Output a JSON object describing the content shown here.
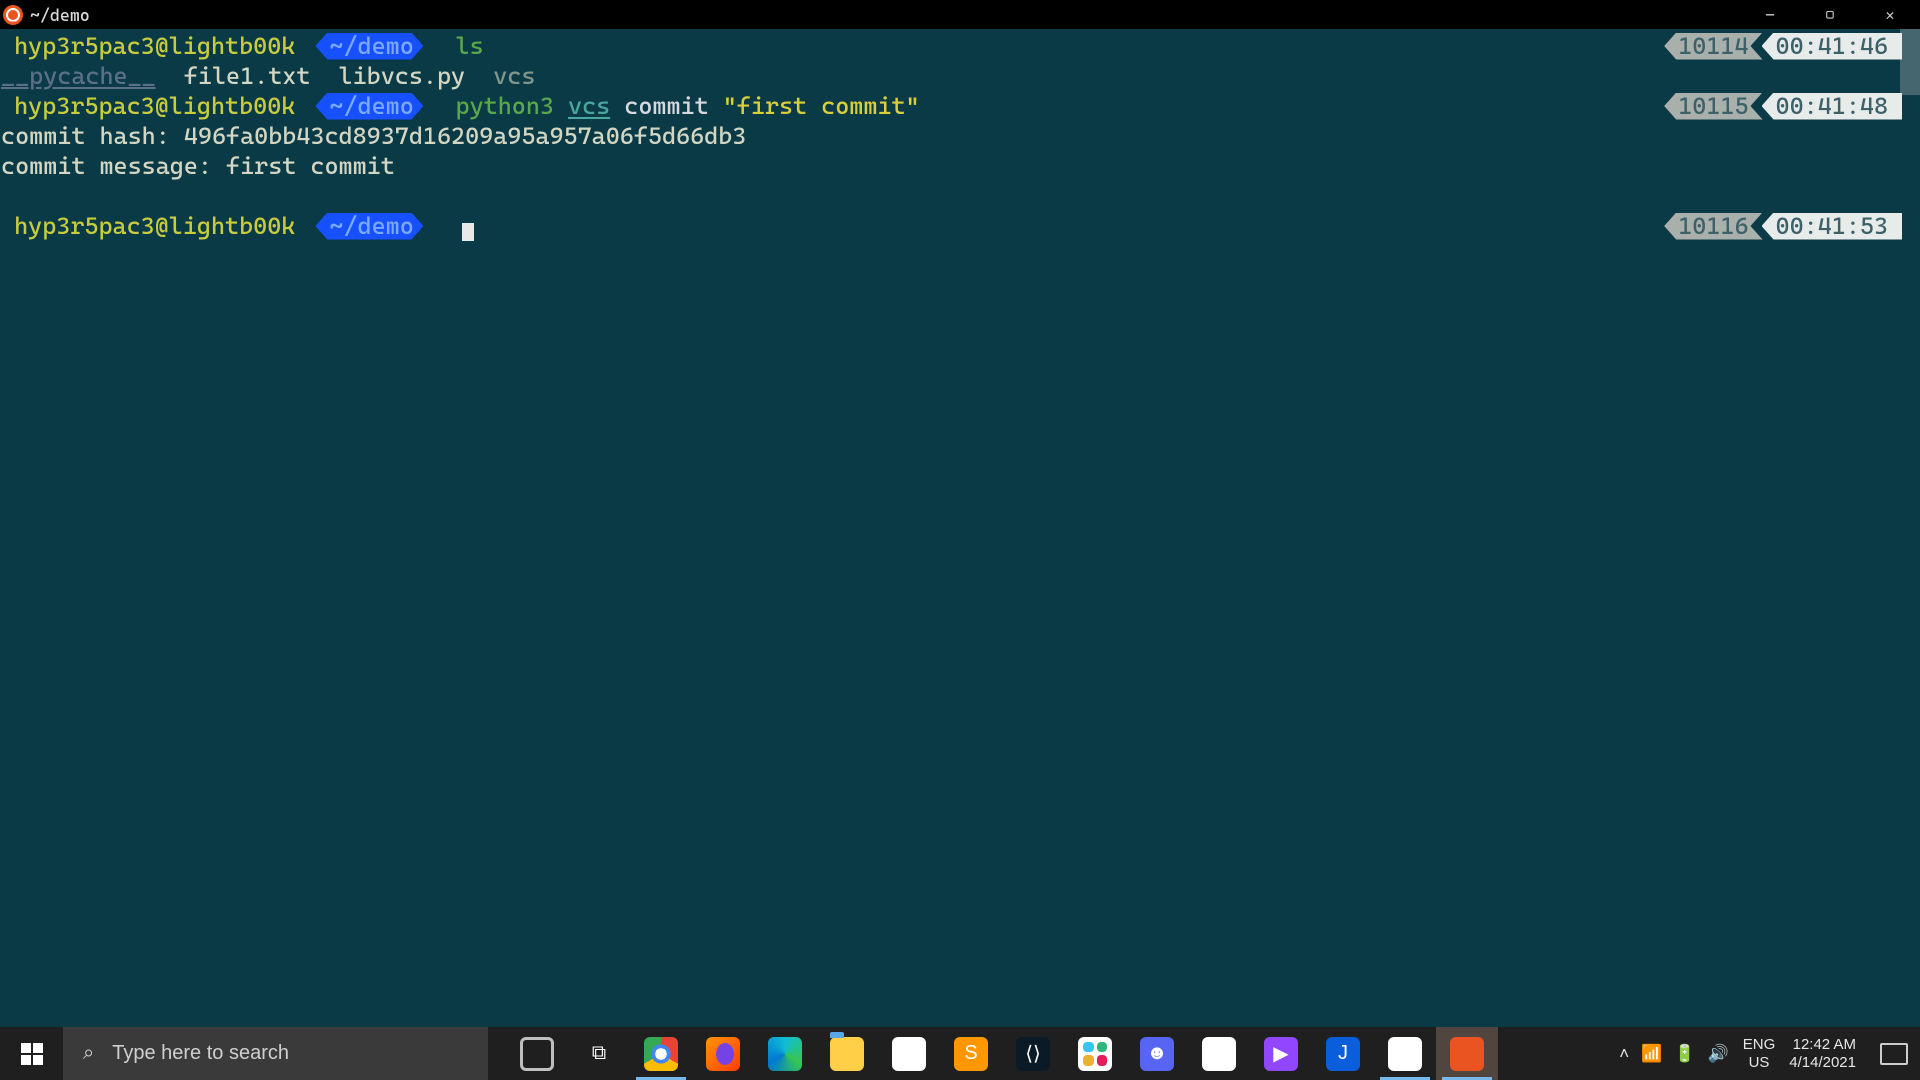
{
  "window": {
    "title": "~/demo",
    "minimize_glyph": "—",
    "maximize_glyph": "▢",
    "close_glyph": "✕"
  },
  "prompt": {
    "user_host": "hyp3r5pac3@lightb00k",
    "dir_label": "~/demo"
  },
  "lines": [
    {
      "hist": "10114",
      "time": "00:41:46",
      "cmd_green": "ls"
    },
    {
      "ls_out": {
        "dir": "__pycache__",
        "f1": "file1.txt",
        "f2": "libvcs.py",
        "f3": "vcs"
      }
    },
    {
      "hist": "10115",
      "time": "00:41:48",
      "cmd_parts": {
        "python3": "python3",
        "vcs": "vcs",
        "commit": "commit",
        "msg": "\"first commit\""
      }
    },
    {
      "out1": "commit hash: 496fa0bb43cd8937d16209a95a957a06f5d66db3"
    },
    {
      "out2": "commit message: first commit"
    },
    {
      "hist": "10116",
      "time": "00:41:53",
      "empty_prompt": true
    }
  ],
  "taskbar": {
    "search_placeholder": "Type here to search",
    "apps": [
      {
        "name": "cortana-icon"
      },
      {
        "name": "taskview-icon"
      },
      {
        "name": "chrome-icon"
      },
      {
        "name": "firefox-icon"
      },
      {
        "name": "edge-icon"
      },
      {
        "name": "file-explorer-icon"
      },
      {
        "name": "dropbox-icon"
      },
      {
        "name": "sublime-icon"
      },
      {
        "name": "vscode-icon"
      },
      {
        "name": "slack-icon"
      },
      {
        "name": "discord-icon"
      },
      {
        "name": "messages-icon"
      },
      {
        "name": "twitch-icon"
      },
      {
        "name": "joplin-icon"
      },
      {
        "name": "brave-icon"
      },
      {
        "name": "ubuntu-icon"
      }
    ],
    "lang_top": "ENG",
    "lang_bot": "US",
    "clock_top": "12:42 AM",
    "clock_bot": "4/14/2021",
    "tray": {
      "chevron": "˄",
      "wifi": "⚶",
      "battery": "▭",
      "volume": "🔊"
    }
  }
}
